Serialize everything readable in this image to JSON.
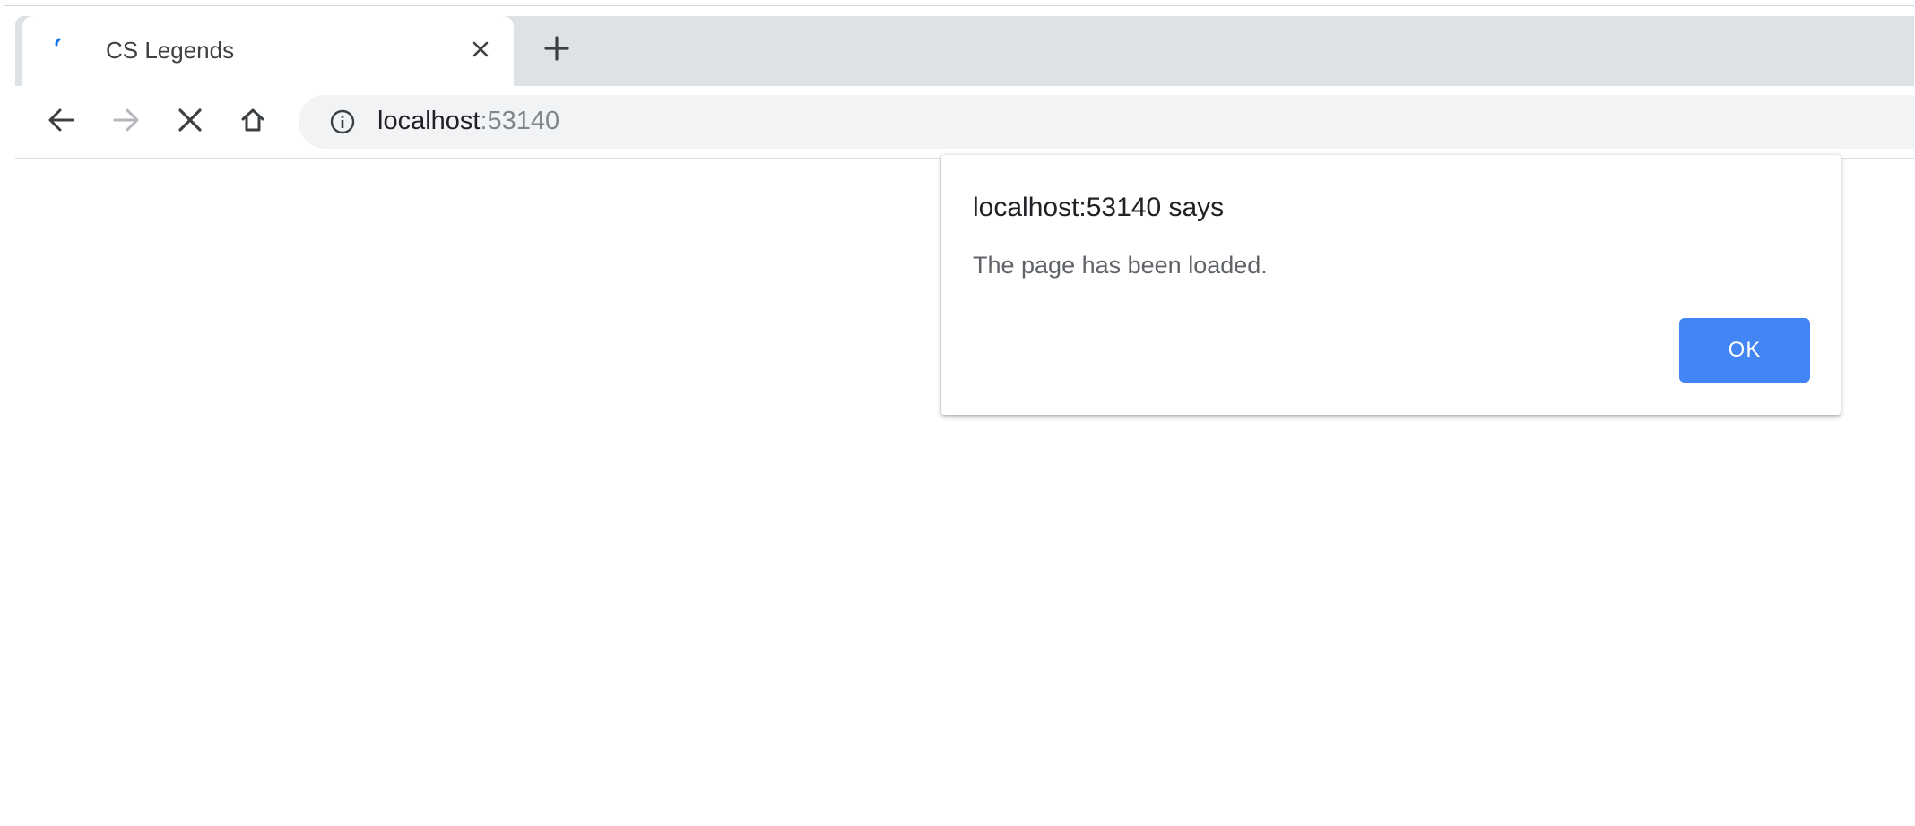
{
  "tab": {
    "title": "CS Legends",
    "favicon_icon": "loading-spinner-icon",
    "close_icon": "close-icon"
  },
  "new_tab_icon": "plus-icon",
  "toolbar": {
    "back_icon": "back-arrow-icon",
    "forward_icon": "forward-arrow-icon",
    "stop_icon": "stop-loading-icon",
    "home_icon": "home-icon",
    "site_info_icon": "info-icon",
    "url_host": "localhost",
    "url_port": ":53140"
  },
  "dialog": {
    "title": "localhost:53140 says",
    "message": "The page has been loaded.",
    "ok_label": "OK"
  },
  "colors": {
    "tab_strip": "#dee1e6",
    "omnibox": "#f1f3f4",
    "accent_button": "#4285f4",
    "spinner": "#1a73e8"
  }
}
